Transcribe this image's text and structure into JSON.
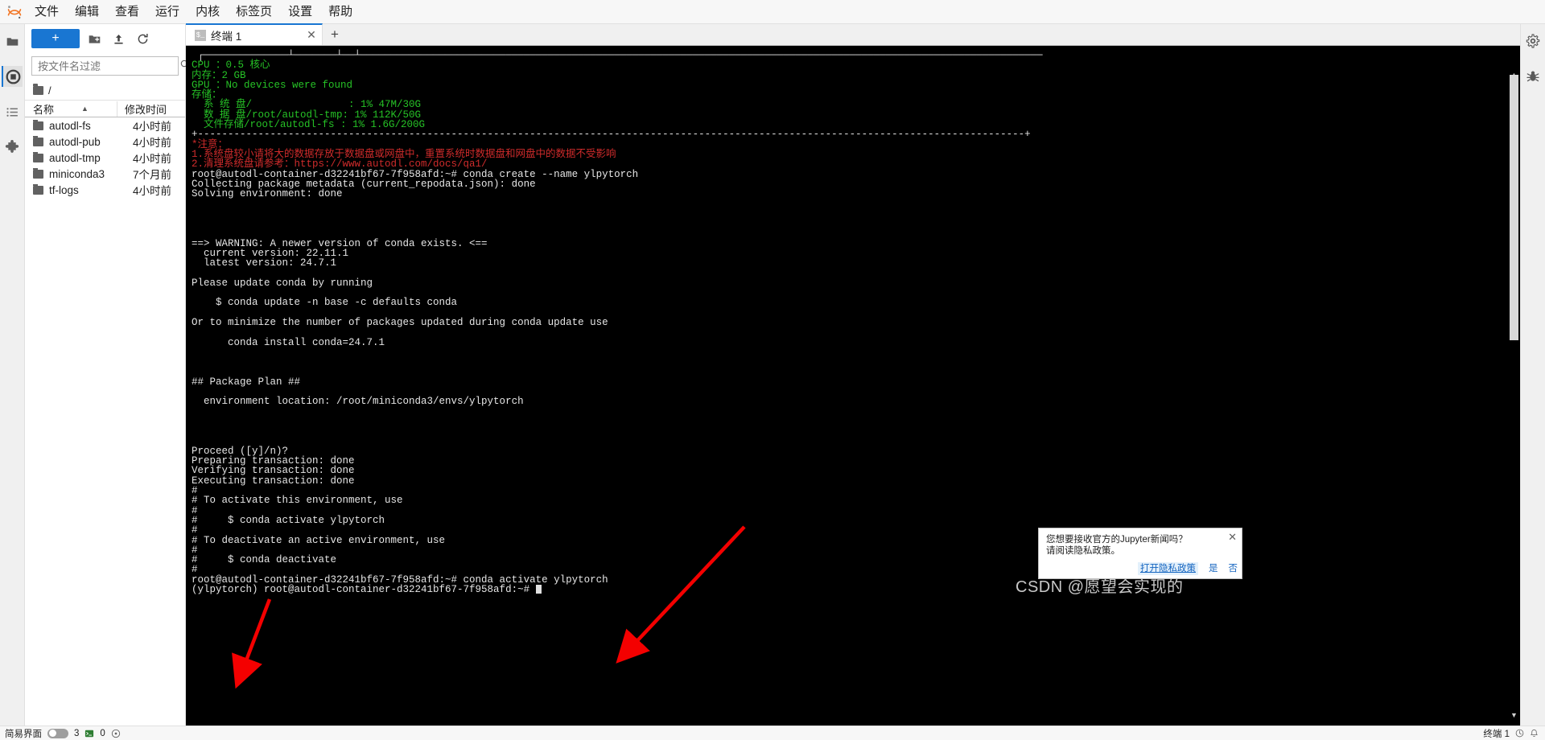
{
  "app": {
    "logo_icon": "jupyter-logo-icon"
  },
  "menubar": {
    "items": [
      {
        "label": "文件",
        "name": "menu-file"
      },
      {
        "label": "编辑",
        "name": "menu-edit"
      },
      {
        "label": "查看",
        "name": "menu-view"
      },
      {
        "label": "运行",
        "name": "menu-run"
      },
      {
        "label": "内核",
        "name": "menu-kernel"
      },
      {
        "label": "标签页",
        "name": "menu-tabs"
      },
      {
        "label": "设置",
        "name": "menu-settings"
      },
      {
        "label": "帮助",
        "name": "menu-help"
      }
    ]
  },
  "left_rail": {
    "items": [
      {
        "name": "file-browser-icon",
        "glyph": "folder"
      },
      {
        "name": "running-terminals-icon",
        "glyph": "stop-circle"
      },
      {
        "name": "table-of-contents-icon",
        "glyph": "list"
      },
      {
        "name": "extension-manager-icon",
        "glyph": "puzzle"
      }
    ]
  },
  "right_rail": {
    "items": [
      {
        "name": "property-inspector-icon",
        "glyph": "gear"
      },
      {
        "name": "debugger-icon",
        "glyph": "bug"
      }
    ]
  },
  "filebrowser": {
    "new_launcher_label": "+",
    "toolbar": [
      {
        "name": "new-folder-button",
        "glyph": "folder-plus"
      },
      {
        "name": "upload-button",
        "glyph": "upload"
      },
      {
        "name": "refresh-button",
        "glyph": "refresh"
      }
    ],
    "filter_placeholder": "按文件名过滤",
    "filter_value": "",
    "search_icon": "search-icon",
    "breadcrumb": "/",
    "columns": {
      "name": "名称",
      "modified": "修改时间"
    },
    "sort_indicator": "▲",
    "items": [
      {
        "name": "autodl-fs",
        "modified": "4小时前"
      },
      {
        "name": "autodl-pub",
        "modified": "4小时前"
      },
      {
        "name": "autodl-tmp",
        "modified": "4小时前"
      },
      {
        "name": "miniconda3",
        "modified": "7个月前"
      },
      {
        "name": "tf-logs",
        "modified": "4小时前"
      }
    ]
  },
  "dock": {
    "tab": {
      "label": "终端 1",
      "icon": "terminal-icon",
      "close_label": "✕"
    },
    "add_tab_label": "+"
  },
  "terminal": {
    "lines": [
      {
        "text": " ┌──────────────┴───────┴──┴─────────────────────────────────────────────────────────────────────────────────────────────────────────────────",
        "color": "white"
      },
      {
        "text": "CPU ：0.5 核心",
        "color": "green"
      },
      {
        "text": "内存：2 GB",
        "color": "green"
      },
      {
        "text": "GPU ：No devices were found",
        "color": "green"
      },
      {
        "text": "存储：",
        "color": "green"
      },
      {
        "text": "  系 统 盘/                : 1% 47M/30G",
        "color": "green"
      },
      {
        "text": "  数 据 盘/root/autodl-tmp: 1% 112K/50G",
        "color": "green"
      },
      {
        "text": "  文件存储/root/autodl-fs : 1% 1.6G/200G",
        "color": "green"
      },
      {
        "text": "+-----------------------------------------------------------------------------------------------------------------------------------------+",
        "color": "white"
      },
      {
        "text": "*注意：",
        "color": "red"
      },
      {
        "text": "1.系统盘较小请将大的数据存放于数据盘或网盘中，重置系统时数据盘和网盘中的数据不受影响",
        "color": "red"
      },
      {
        "text": "2.清理系统盘请参考：https://www.autodl.com/docs/qa1/",
        "color": "red"
      },
      {
        "text": "root@autodl-container-d32241bf67-7f958afd:~# conda create --name ylpytorch",
        "color": "white"
      },
      {
        "text": "Collecting package metadata (current_repodata.json): done",
        "color": "white"
      },
      {
        "text": "Solving environment: done",
        "color": "white"
      },
      {
        "text": "",
        "color": "white"
      },
      {
        "text": "",
        "color": "white"
      },
      {
        "text": "",
        "color": "white"
      },
      {
        "text": "",
        "color": "white"
      },
      {
        "text": "==> WARNING: A newer version of conda exists. <==",
        "color": "white"
      },
      {
        "text": "  current version: 22.11.1",
        "color": "white"
      },
      {
        "text": "  latest version: 24.7.1",
        "color": "white"
      },
      {
        "text": "",
        "color": "white"
      },
      {
        "text": "Please update conda by running",
        "color": "white"
      },
      {
        "text": "",
        "color": "white"
      },
      {
        "text": "    $ conda update -n base -c defaults conda",
        "color": "white"
      },
      {
        "text": "",
        "color": "white"
      },
      {
        "text": "Or to minimize the number of packages updated during conda update use",
        "color": "white"
      },
      {
        "text": "",
        "color": "white"
      },
      {
        "text": "      conda install conda=24.7.1",
        "color": "white"
      },
      {
        "text": "",
        "color": "white"
      },
      {
        "text": "",
        "color": "white"
      },
      {
        "text": "",
        "color": "white"
      },
      {
        "text": "## Package Plan ##",
        "color": "white"
      },
      {
        "text": "",
        "color": "white"
      },
      {
        "text": "  environment location: /root/miniconda3/envs/ylpytorch",
        "color": "white"
      },
      {
        "text": "",
        "color": "white"
      },
      {
        "text": "",
        "color": "white"
      },
      {
        "text": "",
        "color": "white"
      },
      {
        "text": "",
        "color": "white"
      },
      {
        "text": "Proceed ([y]/n)?",
        "color": "white"
      },
      {
        "text": "Preparing transaction: done",
        "color": "white"
      },
      {
        "text": "Verifying transaction: done",
        "color": "white"
      },
      {
        "text": "Executing transaction: done",
        "color": "white"
      },
      {
        "text": "#",
        "color": "white"
      },
      {
        "text": "# To activate this environment, use",
        "color": "white"
      },
      {
        "text": "#",
        "color": "white"
      },
      {
        "text": "#     $ conda activate ylpytorch",
        "color": "white"
      },
      {
        "text": "#",
        "color": "white"
      },
      {
        "text": "# To deactivate an active environment, use",
        "color": "white"
      },
      {
        "text": "#",
        "color": "white"
      },
      {
        "text": "#     $ conda deactivate",
        "color": "white"
      },
      {
        "text": "#",
        "color": "white"
      },
      {
        "text": "root@autodl-container-d32241bf67-7f958afd:~# conda activate ylpytorch",
        "color": "white"
      },
      {
        "text": "(ylpytorch) root@autodl-container-d32241bf67-7f958afd:~#",
        "color": "white",
        "cursor": true
      }
    ]
  },
  "toast": {
    "line1": "您想要接收官方的Jupyter新闻吗？",
    "line2": "请阅读隐私政策。",
    "privacy_link": "打开隐私政策",
    "yes": "是",
    "no": "否",
    "close_label": "✕"
  },
  "statusbar": {
    "simple_mode_label": "简易界面",
    "simple_mode_on": false,
    "terminals_count": "3",
    "kernels_count": "0",
    "right_label": "终端 1"
  },
  "watermark": {
    "text": "CSDN @愿望会实现的"
  },
  "colors": {
    "accent_blue": "#1976d2",
    "terminal_bg": "#000000",
    "terminal_green": "#26c226",
    "terminal_red": "#cf2b2b",
    "annotation_red": "#f40000"
  }
}
